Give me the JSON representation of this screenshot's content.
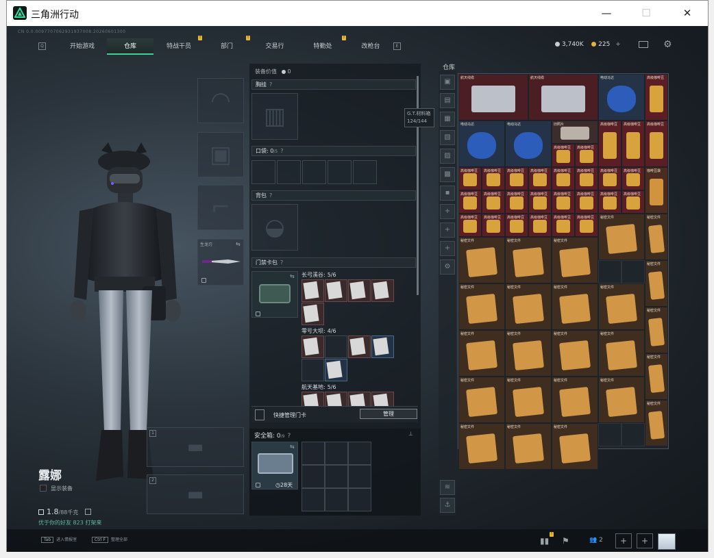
{
  "window": {
    "title": "三角洲行动",
    "minimize": "—",
    "maximize": "☐",
    "close": "✕"
  },
  "game_id": "CN 0.0.0097707062931937008.20260601300",
  "nav": {
    "left_key": "Q",
    "right_key": "E",
    "tabs": [
      {
        "label": "开始游戏",
        "active": false,
        "badge": ""
      },
      {
        "label": "仓库",
        "active": true,
        "badge": ""
      },
      {
        "label": "特战干员",
        "active": false,
        "badge": "!"
      },
      {
        "label": "部门",
        "active": false,
        "badge": "!"
      },
      {
        "label": "交易行",
        "active": false,
        "badge": ""
      },
      {
        "label": "特勤处",
        "active": false,
        "badge": "!"
      },
      {
        "label": "改枪台",
        "active": false,
        "badge": ""
      }
    ]
  },
  "currency": {
    "coins": "3,740K",
    "premium": "225",
    "plus": "+",
    "coin_color": "#c8ccd0",
    "premium_color": "#e2b43a"
  },
  "operator": {
    "name": "露娜",
    "show_gear_label": "显示装备",
    "weight_value": "1.8",
    "weight_unit": "/88千克",
    "weight_sub": "优于你的好友 823 打架来"
  },
  "equip": {
    "weapon_label": "生龙刃",
    "weapon_slot_1": "1",
    "weapon_slot_2": "2"
  },
  "mid": {
    "value_label": "装备价值",
    "value": "0",
    "chest_label": "胸挂",
    "pocket_label": "口袋:",
    "pocket_value": "0",
    "pocket_unit": "/5",
    "backpack_label": "背包",
    "keycard_label": "门禁卡包",
    "keycard_groups": [
      {
        "name": "长弓溪谷:",
        "count": "5/6"
      },
      {
        "name": "零号大坝:",
        "count": "4/6"
      },
      {
        "name": "航天基地:",
        "count": "5/6"
      }
    ],
    "quick_label": "快捷管理门卡",
    "quick_button": "管理",
    "safebox_label": "安全箱:",
    "safebox_value": "0",
    "safebox_unit": "/9",
    "safebox_days": "28天"
  },
  "stash": {
    "title": "仓库",
    "tooltip_name": "G.T.材料箱",
    "tooltip_count": "124/144",
    "item_labels": {
      "cable": "航天线缆",
      "motor": "电动马达",
      "coffee": "高级咖啡豆",
      "photo": "旧照片",
      "doc": "秘密文件",
      "bag": "咖啡豆袋"
    }
  },
  "footer": {
    "key1": "Tab",
    "label1": "进入情报室",
    "key2": "Ctrl F",
    "label2": "整理全部",
    "chart_badge": "!",
    "friends": "2",
    "add": "+"
  }
}
